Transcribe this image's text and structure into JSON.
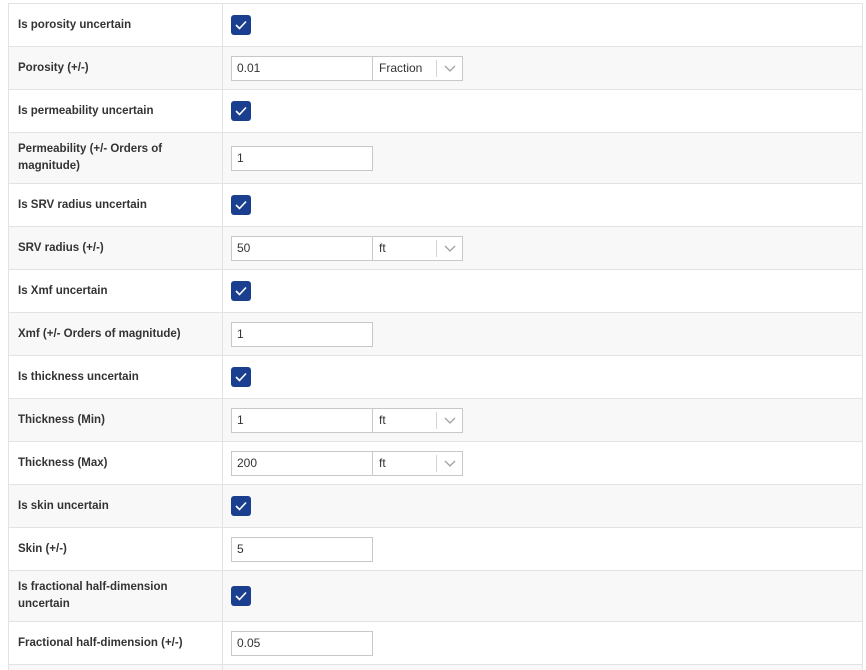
{
  "rows": [
    {
      "label": "Is porosity uncertain",
      "type": "checkbox",
      "checked": true
    },
    {
      "label": "Porosity (+/-)",
      "type": "input-unit",
      "value": "0.01",
      "unit": "Fraction"
    },
    {
      "label": "Is permeability uncertain",
      "type": "checkbox",
      "checked": true
    },
    {
      "label": "Permeability (+/- Orders of magnitude)",
      "type": "input",
      "value": "1"
    },
    {
      "label": "Is SRV radius uncertain",
      "type": "checkbox",
      "checked": true
    },
    {
      "label": "SRV radius (+/-)",
      "type": "input-unit",
      "value": "50",
      "unit": "ft"
    },
    {
      "label": "Is Xmf uncertain",
      "type": "checkbox",
      "checked": true
    },
    {
      "label": "Xmf (+/- Orders of magnitude)",
      "type": "input",
      "value": "1"
    },
    {
      "label": "Is thickness uncertain",
      "type": "checkbox",
      "checked": true
    },
    {
      "label": "Thickness (Min)",
      "type": "input-unit",
      "value": "1",
      "unit": "ft"
    },
    {
      "label": "Thickness (Max)",
      "type": "input-unit",
      "value": "200",
      "unit": "ft"
    },
    {
      "label": "Is skin uncertain",
      "type": "checkbox",
      "checked": true
    },
    {
      "label": "Skin (+/-)",
      "type": "input",
      "value": "5"
    },
    {
      "label": "Is fractional half-dimension uncertain",
      "type": "checkbox",
      "checked": true
    },
    {
      "label": "Fractional half-dimension (+/-)",
      "type": "input",
      "value": "0.05"
    }
  ],
  "colors": {
    "checkbox": "#1b3f8f",
    "row_alt": "#f8f8f8",
    "border": "#e3e3e3"
  },
  "icons": {
    "checkbox": "checkmark-icon",
    "select": "chevron-down-icon"
  }
}
